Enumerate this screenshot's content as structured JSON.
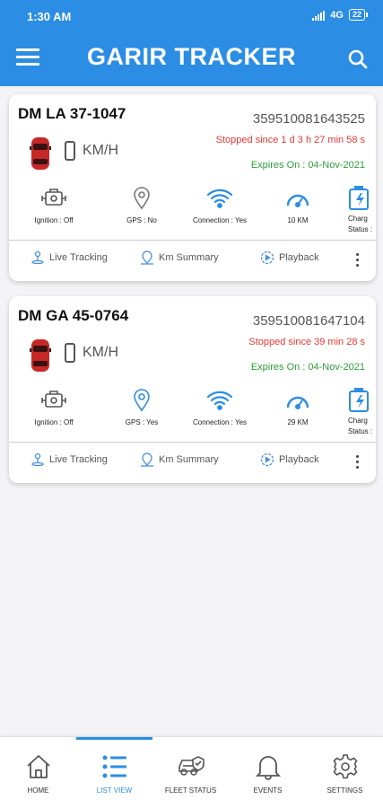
{
  "status_bar": {
    "time": "1:30 AM",
    "network": "4G",
    "battery": "22"
  },
  "app_bar": {
    "title": "GARIR TRACKER",
    "menu_icon": "hamburger-menu-icon",
    "search_icon": "search-icon"
  },
  "vehicles": [
    {
      "plate": "DM LA 37-1047",
      "imei": "359510081643525",
      "stopped": "Stopped since 1 d 3 h 27 min 58 s",
      "expires": "Expires On : 04-Nov-2021",
      "speed_unit": "KM/H",
      "features": {
        "ignition": "Ignition : Off",
        "gps": "GPS : No",
        "connection": "Connection : Yes",
        "distance": "10 KM",
        "charge": "Charg",
        "charge2": "Status :"
      },
      "actions": {
        "live": "Live Tracking",
        "summary": "Km Summary",
        "playback": "Playback"
      }
    },
    {
      "plate": "DM GA 45-0764",
      "imei": "359510081647104",
      "stopped": "Stopped since 39 min 28 s",
      "expires": "Expires On : 04-Nov-2021",
      "speed_unit": "KM/H",
      "features": {
        "ignition": "Ignition : Off",
        "gps": "GPS : Yes",
        "connection": "Connection : Yes",
        "distance": "29 KM",
        "charge": "Charg",
        "charge2": "Status :"
      },
      "actions": {
        "live": "Live Tracking",
        "summary": "Km Summary",
        "playback": "Playback"
      }
    }
  ],
  "bottom_nav": [
    {
      "label": "HOME",
      "icon": "home-icon"
    },
    {
      "label": "LIST VIEW",
      "icon": "list-view-icon",
      "active": true
    },
    {
      "label": "FLEET STATUS",
      "icon": "fleet-status-icon"
    },
    {
      "label": "EVENTS",
      "icon": "bell-icon"
    },
    {
      "label": "SETTINGS",
      "icon": "gear-icon"
    }
  ],
  "colors": {
    "primary": "#2b8de3",
    "stopped": "#e53935",
    "expires": "#2e9e3a",
    "car": "#c62828"
  }
}
